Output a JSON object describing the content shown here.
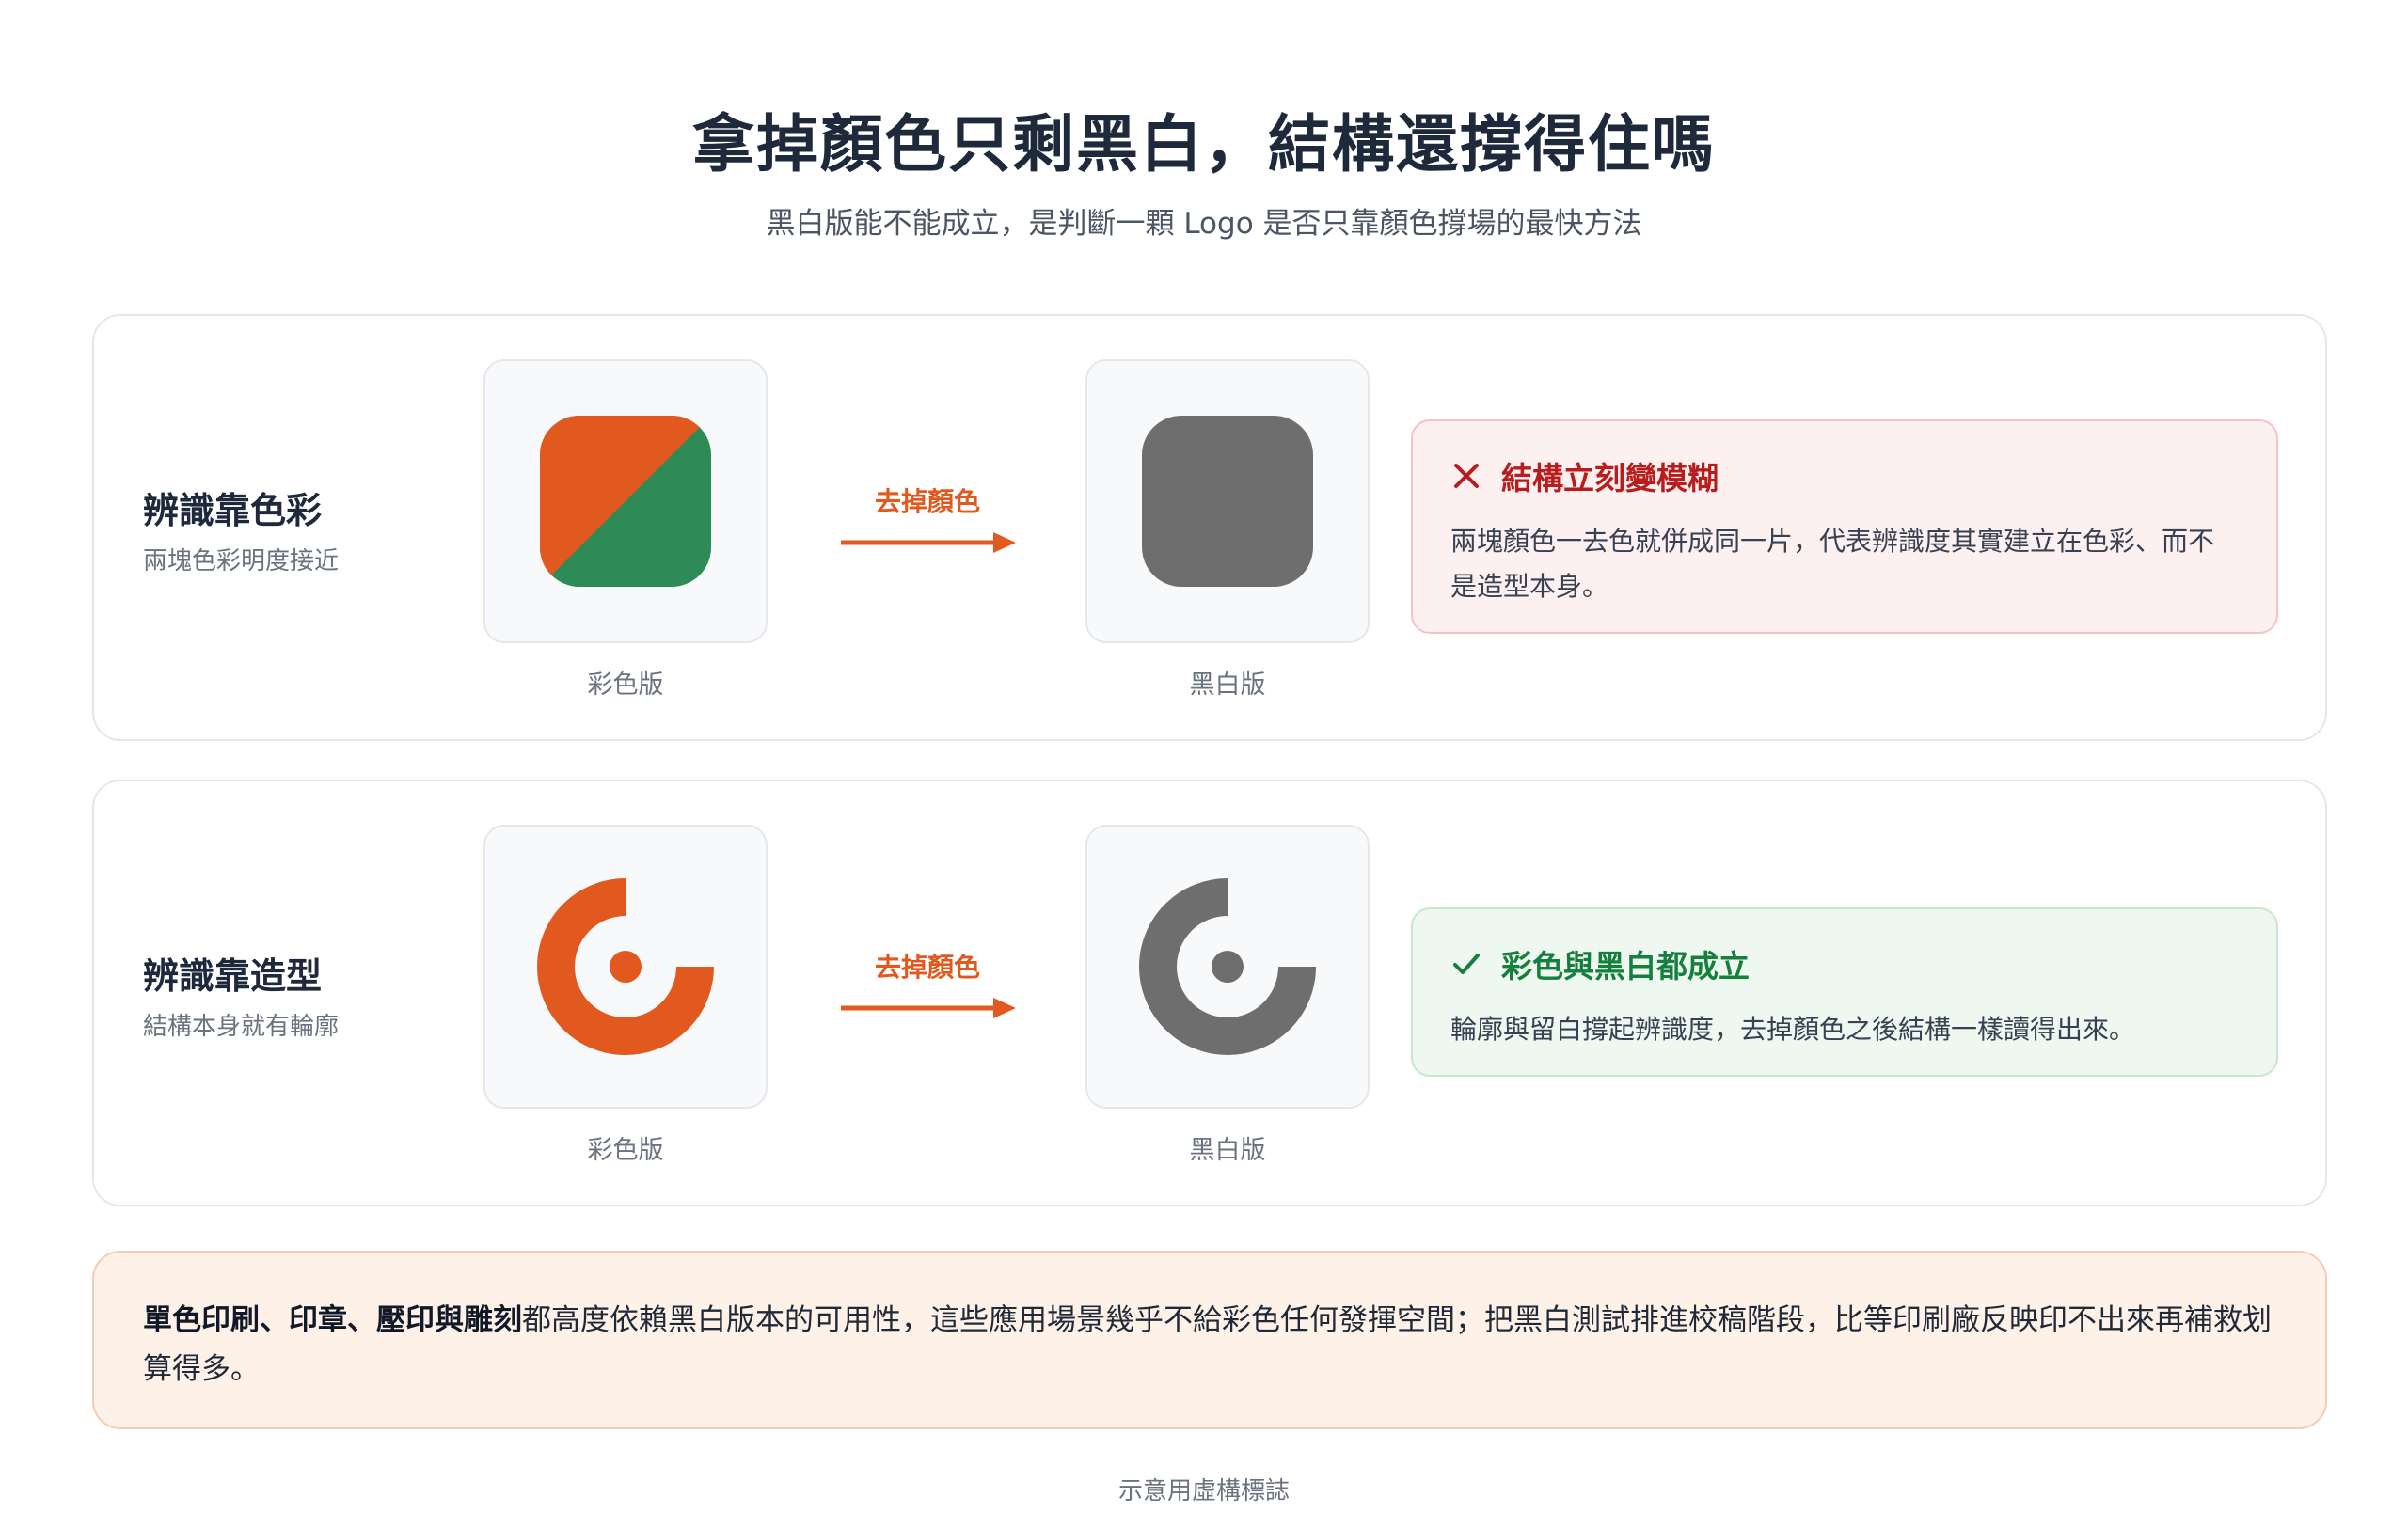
{
  "header": {
    "title": "拿掉顏色只剩黑白，結構還撐得住嗎",
    "subtitle": "黑白版能不能成立，是判斷一顆 Logo 是否只靠顏色撐場的最快方法"
  },
  "rows": [
    {
      "title": "辨識靠色彩",
      "subtitle": "兩塊色彩明度接近",
      "color_caption": "彩色版",
      "arrow_label": "去掉顏色",
      "bw_caption": "黑白版",
      "verdict": {
        "status": "fail",
        "heading": "結構立刻變模糊",
        "body": "兩塊顏色一去色就併成同一片，代表辨識度其實建立在色彩、而不是造型本身。"
      }
    },
    {
      "title": "辨識靠造型",
      "subtitle": "結構本身就有輪廓",
      "color_caption": "彩色版",
      "arrow_label": "去掉顏色",
      "bw_caption": "黑白版",
      "verdict": {
        "status": "pass",
        "heading": "彩色與黑白都成立",
        "body": "輪廓與留白撐起辨識度，去掉顏色之後結構一樣讀得出來。"
      }
    }
  ],
  "bottom_note": {
    "emphasis": "單色印刷、印章、壓印與雕刻",
    "text": "都高度依賴黑白版本的可用性，這些應用場景幾乎不給彩色任何發揮空間；把黑白測試排進校稿階段，比等印刷廠反映印不出來再補救划算得多。"
  },
  "footnote": "示意用虛構標誌",
  "colors": {
    "accent_orange": "#e2591f",
    "logo_green": "#2e8b57",
    "grey": "#6e6e6e",
    "fail_red": "#b91c1c",
    "pass_green": "#15803d"
  },
  "icons": {
    "fail": "x-icon",
    "pass": "check-icon",
    "arrow": "arrow-right-icon"
  }
}
